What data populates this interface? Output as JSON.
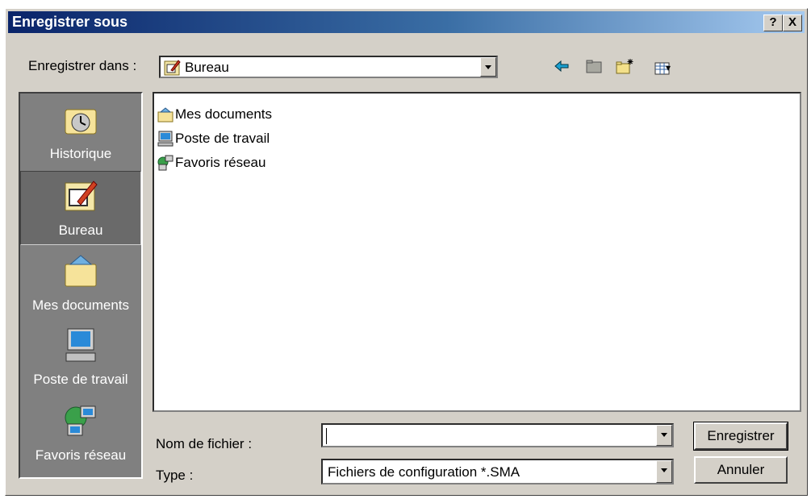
{
  "window": {
    "title": "Enregistrer sous",
    "help_label": "?",
    "close_label": "X"
  },
  "location": {
    "label": "Enregistrer dans :",
    "value": "Bureau",
    "value_icon": "desktop-icon"
  },
  "toolbar": {
    "icons": [
      "back-arrow-icon",
      "up-folder-icon",
      "new-folder-icon",
      "view-menu-icon"
    ],
    "view_arrow": "▾"
  },
  "places": [
    {
      "label": "Historique",
      "icon": "history-icon"
    },
    {
      "label": "Bureau",
      "icon": "desktop-icon",
      "selected": true
    },
    {
      "label": "Mes documents",
      "icon": "my-documents-icon"
    },
    {
      "label": "Poste de travail",
      "icon": "my-computer-icon"
    },
    {
      "label": "Favoris réseau",
      "icon": "network-places-icon"
    }
  ],
  "files": [
    {
      "label": "Mes documents",
      "icon": "my-documents-icon"
    },
    {
      "label": "Poste de travail",
      "icon": "my-computer-icon"
    },
    {
      "label": "Favoris réseau",
      "icon": "network-places-icon"
    }
  ],
  "form": {
    "filename_label": "Nom de fichier :",
    "filename_value": "",
    "type_label": "Type :",
    "type_value": "Fichiers de configuration *.SMA"
  },
  "buttons": {
    "save": "Enregistrer",
    "cancel": "Annuler"
  },
  "colors": {
    "face": "#d4d0c8",
    "title_start": "#0a246a",
    "title_end": "#a6caf0",
    "places_bg": "#808080"
  }
}
